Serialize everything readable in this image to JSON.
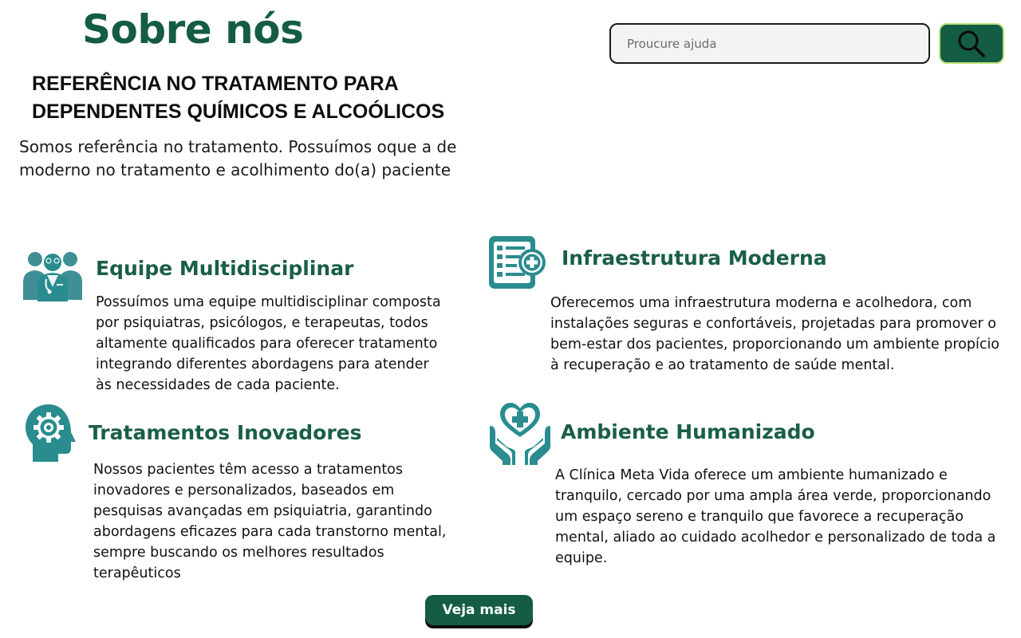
{
  "header": {
    "title": "Sobre nós",
    "subtitle": "REFERÊNCIA NO TRATAMENTO PARA DEPENDENTES QUÍMICOS E ALCOÓLICOS",
    "intro": "Somos referência no tratamento. Possuímos oque a de moderno no tratamento e acolhimento do(a) paciente"
  },
  "search": {
    "placeholder": "Proucure ajuda",
    "value": "",
    "button_icon": "search-icon"
  },
  "features": [
    {
      "icon": "medical-team-icon",
      "title": "Equipe Multidisciplinar",
      "text": "Possuímos uma equipe multidisciplinar composta por psiquiatras, psicólogos, e terapeutas, todos altamente qualificados para oferecer tratamento integrando diferentes abordagens para atender às necessidades de cada paciente."
    },
    {
      "icon": "medical-checklist-icon",
      "title": "Infraestrutura Moderna",
      "text": "Oferecemos uma infraestrutura moderna e acolhedora, com instalações seguras e confortáveis, projetadas para promover o bem-estar dos pacientes, proporcionando um ambiente propício à recuperação e ao tratamento de saúde mental."
    },
    {
      "icon": "head-gear-icon",
      "title": "Tratamentos Inovadores",
      "text": "Nossos pacientes têm acesso a tratamentos inovadores e personalizados, baseados em pesquisas avançadas em psiquiatria, garantindo abordagens eficazes para cada transtorno mental, sempre buscando os melhores resultados terapêuticos"
    },
    {
      "icon": "hands-heart-icon",
      "title": "Ambiente Humanizado",
      "text": "A Clínica Meta Vida oferece um ambiente humanizado e tranquilo, cercado por uma ampla área verde, proporcionando um espaço sereno e tranquilo que favorece a recuperação mental, aliado ao cuidado acolhedor e personalizado de toda a equipe."
    }
  ],
  "more_button": {
    "label": "Veja mais"
  },
  "colors": {
    "brand_green": "#145c44",
    "icon_teal": "#2a8c8e",
    "search_button_border": "#b9e27a"
  }
}
